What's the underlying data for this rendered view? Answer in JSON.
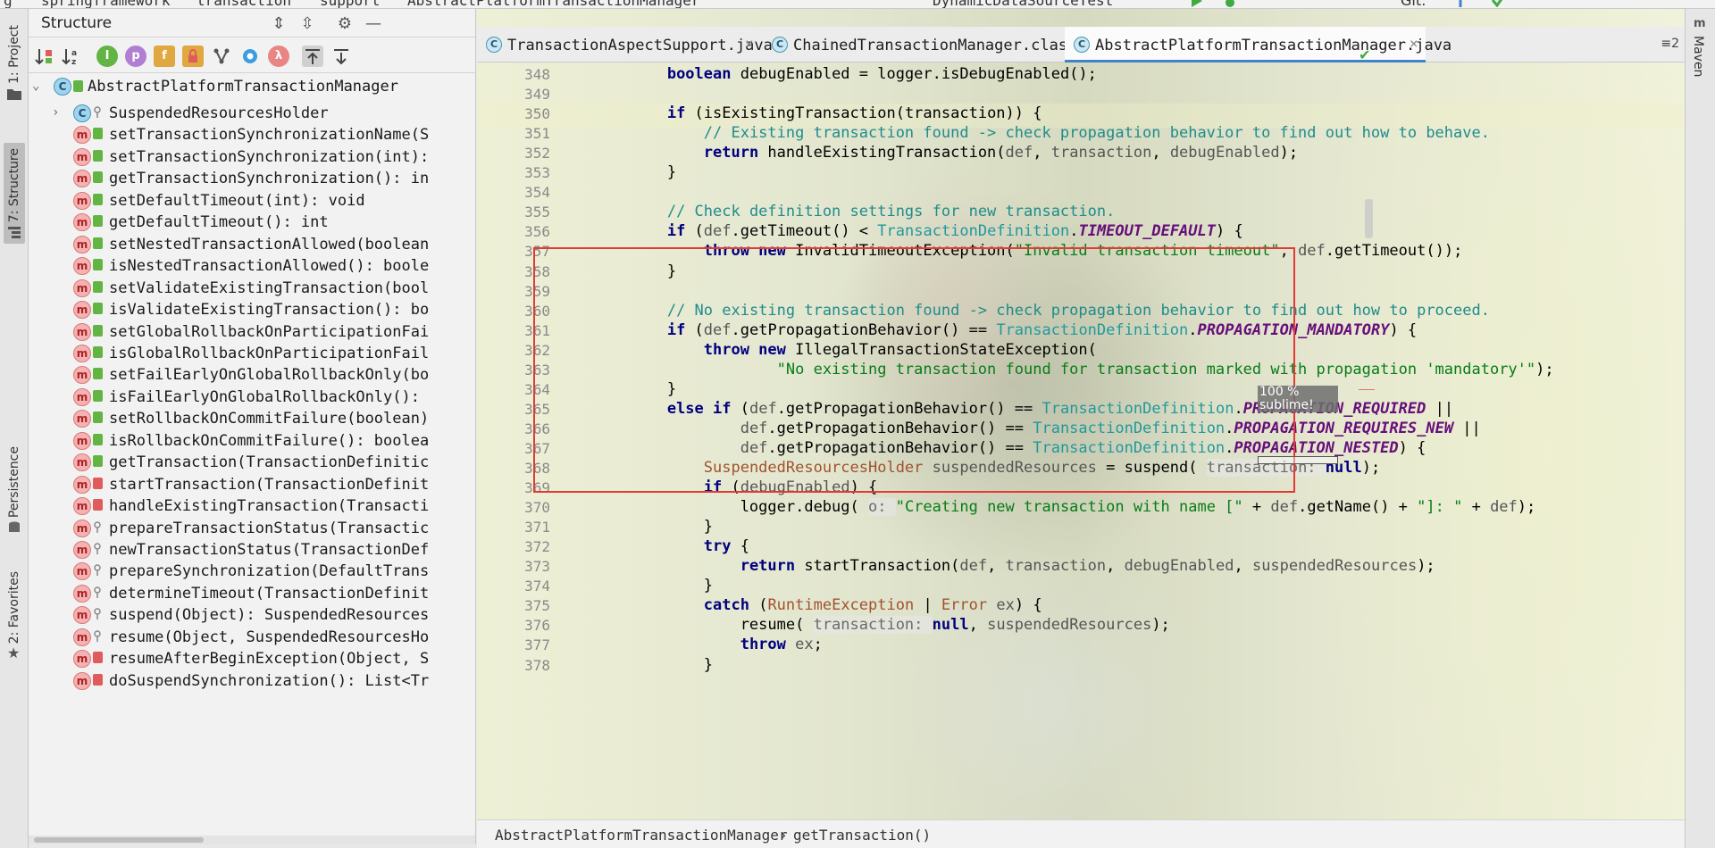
{
  "topbar": {
    "crumbs": [
      "g",
      "springframework",
      "transaction",
      "support",
      "AbstractPlatformTransactionManager"
    ],
    "run_config": "DynamicDataSourceTest",
    "git_label": "Git:"
  },
  "left_stripe": {
    "tabs": [
      {
        "label": "1: Project"
      },
      {
        "label": "7: Structure"
      },
      {
        "label": "Persistence"
      },
      {
        "label": "2: Favorites"
      }
    ]
  },
  "structure": {
    "title": "Structure",
    "toolbar": {
      "sort_visibility": "sort-by-visibility",
      "sort_alpha": "sort-alphabetically",
      "show_inherited": "I",
      "show_properties": "p",
      "show_fields": "f",
      "show_non_public": "lock",
      "show_tree": "hierarchy",
      "show_anonymous": "o",
      "show_lambdas": "λ",
      "autoscroll_to_source": "autoscroll-to-source",
      "autoscroll_from_source": "autoscroll-from-source"
    },
    "root": "AbstractPlatformTransactionManager",
    "items": [
      {
        "label": "SuspendedResourcesHolder",
        "kind": "class",
        "vis": "prot"
      },
      {
        "label": "setTransactionSynchronizationName(S",
        "kind": "method",
        "vis": "pub"
      },
      {
        "label": "setTransactionSynchronization(int):",
        "kind": "method",
        "vis": "pub"
      },
      {
        "label": "getTransactionSynchronization(): in",
        "kind": "method",
        "vis": "pub"
      },
      {
        "label": "setDefaultTimeout(int): void",
        "kind": "method",
        "vis": "pub"
      },
      {
        "label": "getDefaultTimeout(): int",
        "kind": "method",
        "vis": "pub"
      },
      {
        "label": "setNestedTransactionAllowed(boolean",
        "kind": "method",
        "vis": "pub"
      },
      {
        "label": "isNestedTransactionAllowed(): boole",
        "kind": "method",
        "vis": "pub"
      },
      {
        "label": "setValidateExistingTransaction(bool",
        "kind": "method",
        "vis": "pub"
      },
      {
        "label": "isValidateExistingTransaction(): bo",
        "kind": "method",
        "vis": "pub"
      },
      {
        "label": "setGlobalRollbackOnParticipationFai",
        "kind": "method",
        "vis": "pub"
      },
      {
        "label": "isGlobalRollbackOnParticipationFail",
        "kind": "method",
        "vis": "pub"
      },
      {
        "label": "setFailEarlyOnGlobalRollbackOnly(bo",
        "kind": "method",
        "vis": "pub"
      },
      {
        "label": "isFailEarlyOnGlobalRollbackOnly():",
        "kind": "method",
        "vis": "pub"
      },
      {
        "label": "setRollbackOnCommitFailure(boolean)",
        "kind": "method",
        "vis": "pub"
      },
      {
        "label": "isRollbackOnCommitFailure(): boolea",
        "kind": "method",
        "vis": "pub"
      },
      {
        "label": "getTransaction(TransactionDefinitic",
        "kind": "method",
        "vis": "pub"
      },
      {
        "label": "startTransaction(TransactionDefinit",
        "kind": "method",
        "vis": "priv"
      },
      {
        "label": "handleExistingTransaction(Transacti",
        "kind": "method",
        "vis": "priv"
      },
      {
        "label": "prepareTransactionStatus(Transactic",
        "kind": "method",
        "vis": "prot"
      },
      {
        "label": "newTransactionStatus(TransactionDef",
        "kind": "method",
        "vis": "prot"
      },
      {
        "label": "prepareSynchronization(DefaultTrans",
        "kind": "method",
        "vis": "prot"
      },
      {
        "label": "determineTimeout(TransactionDefinit",
        "kind": "method",
        "vis": "prot"
      },
      {
        "label": "suspend(Object): SuspendedResources",
        "kind": "method",
        "vis": "prot"
      },
      {
        "label": "resume(Object, SuspendedResourcesHo",
        "kind": "method",
        "vis": "prot"
      },
      {
        "label": "resumeAfterBeginException(Object, S",
        "kind": "method",
        "vis": "priv"
      },
      {
        "label": "doSuspendSynchronization(): List<Tr",
        "kind": "method",
        "vis": "priv"
      }
    ]
  },
  "editor": {
    "tabs": [
      {
        "label": "TransactionAspectSupport.java",
        "close": "×"
      },
      {
        "label": "ChainedTransactionManager.class",
        "close": "×"
      },
      {
        "label": "AbstractPlatformTransactionManager.java",
        "close": "×"
      }
    ],
    "tab_overflow": "≡2",
    "line_numbers": [
      "348",
      "349",
      "350",
      "351",
      "352",
      "353",
      "354",
      "355",
      "356",
      "357",
      "358",
      "359",
      "360",
      "361",
      "362",
      "363",
      "364",
      "365",
      "366",
      "367",
      "368",
      "369",
      "370",
      "371",
      "372",
      "373",
      "374",
      "375",
      "376",
      "377",
      "378"
    ],
    "overlay_badge": {
      "line1": "100 %",
      "line2": "sublime!"
    },
    "breadcrumb": {
      "class": "AbstractPlatformTransactionManager",
      "sep": "›",
      "method": "getTransaction()"
    }
  },
  "right_stripe": {
    "label": "Maven"
  },
  "colors": {
    "highlight_box": "#e53935",
    "keyword": "#000080",
    "comment": "#1f8c8c",
    "string": "#067d17",
    "constant": "#660e7a"
  }
}
